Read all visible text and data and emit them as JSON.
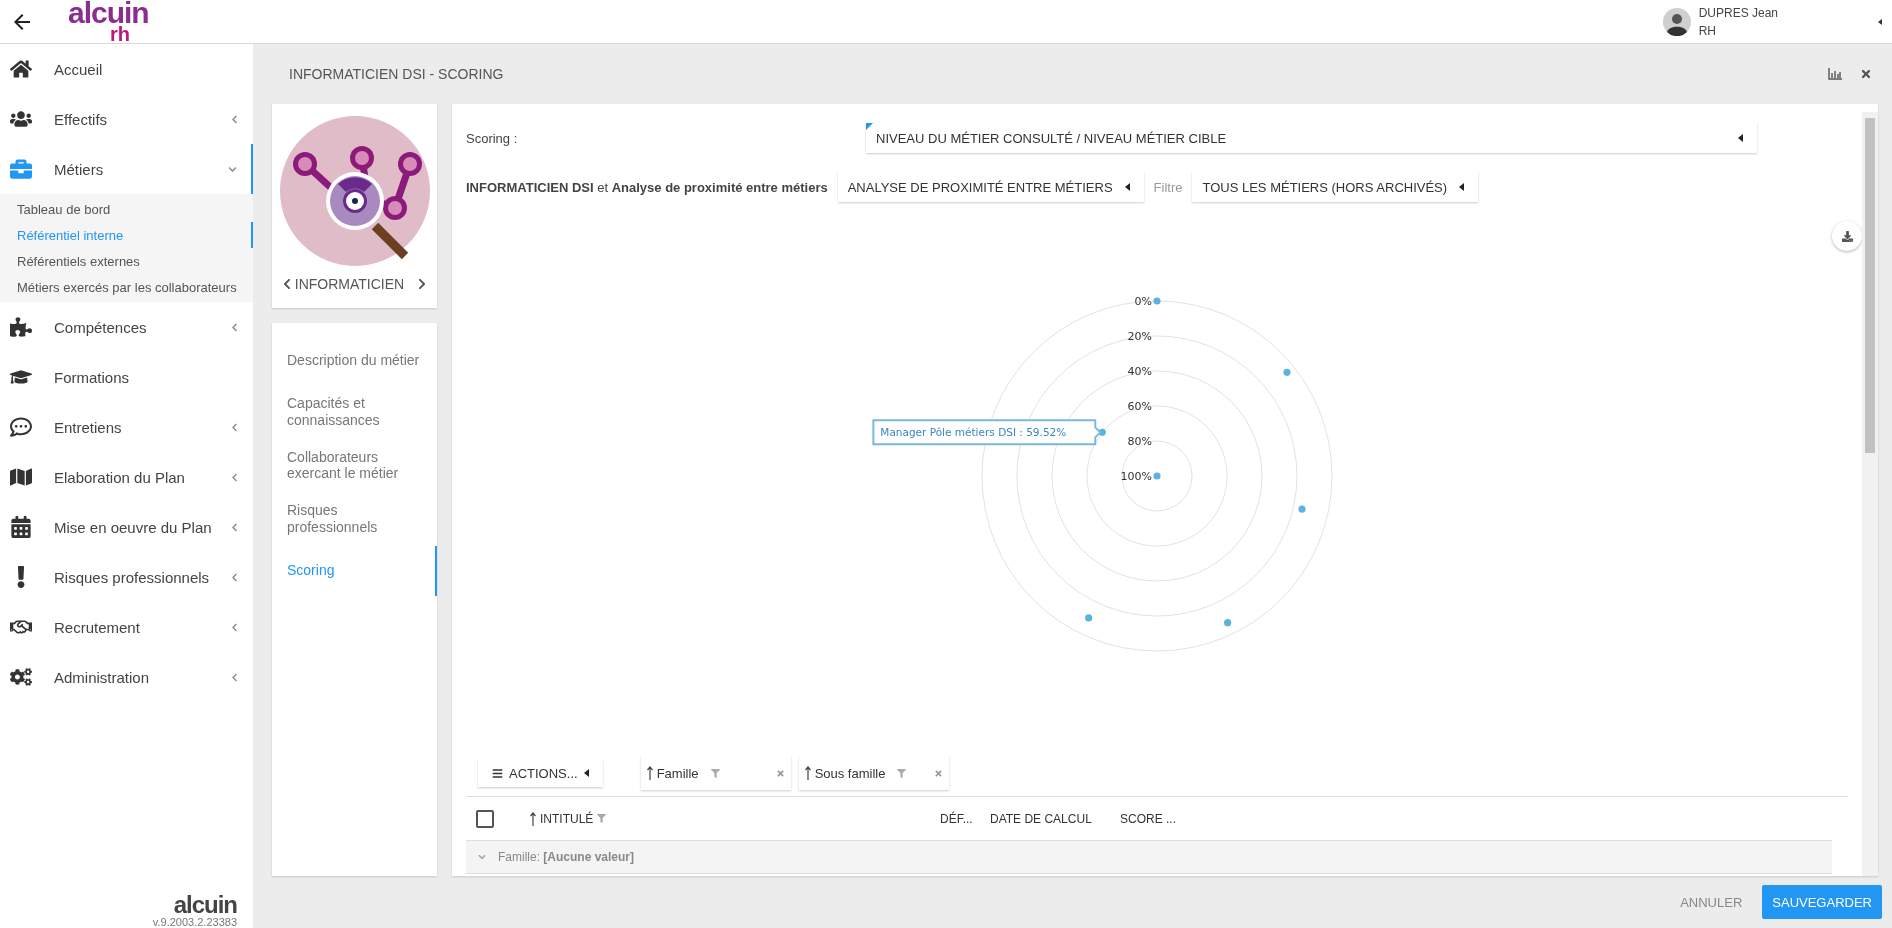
{
  "header": {
    "logo": {
      "name": "alcuin",
      "suffix": "rh"
    },
    "user": {
      "name": "DUPRES Jean",
      "role": "RH"
    }
  },
  "sidebar": {
    "items": [
      {
        "label": "Accueil",
        "kind": "link"
      },
      {
        "label": "Effectifs",
        "kind": "group",
        "expanded": false
      },
      {
        "label": "Métiers",
        "kind": "group",
        "expanded": true,
        "children": [
          {
            "label": "Tableau de bord",
            "selected": false
          },
          {
            "label": "Référentiel interne",
            "selected": true
          },
          {
            "label": "Référentiels externes",
            "selected": false
          },
          {
            "label": "Métiers exercés par les collaborateurs",
            "selected": false
          }
        ]
      },
      {
        "label": "Compétences",
        "kind": "group",
        "expanded": false
      },
      {
        "label": "Formations",
        "kind": "link"
      },
      {
        "label": "Entretiens",
        "kind": "group",
        "expanded": false
      },
      {
        "label": "Elaboration du Plan",
        "kind": "group",
        "expanded": false
      },
      {
        "label": "Mise en oeuvre du Plan",
        "kind": "group",
        "expanded": false
      },
      {
        "label": "Risques professionnels",
        "kind": "group",
        "expanded": false
      },
      {
        "label": "Recrutement",
        "kind": "group",
        "expanded": false
      },
      {
        "label": "Administration",
        "kind": "group",
        "expanded": false
      }
    ],
    "footer": {
      "logo": "alcuin",
      "version": "v.9.2003.2.23383"
    }
  },
  "page": {
    "title": "INFORMATICIEN DSI - SCORING"
  },
  "job_card": {
    "label": "INFORMATICIEN"
  },
  "job_nav": [
    {
      "label": "Description du métier",
      "selected": false
    },
    {
      "label": "Capacités et connaissances",
      "selected": false
    },
    {
      "label": "Collaborateurs exercant le métier",
      "selected": false
    },
    {
      "label": "Risques professionnels",
      "selected": false
    },
    {
      "label": "Scoring",
      "selected": true
    }
  ],
  "scoring": {
    "label": "Scoring :",
    "value": "NIVEAU DU MÉTIER CONSULTÉ / NIVEAU MÉTIER CIBLE"
  },
  "comparison": {
    "text": "**INFORMATICIEN DSI** et **Analyse de proximité entre métiers**",
    "analysis": "ANALYSE DE PROXIMITÉ ENTRE MÉTIERS",
    "filter_label": "Filtre",
    "filter": "TOUS LES MÉTIERS (HORS ARCHIVÉS)"
  },
  "chart": {
    "ring_labels": [
      "0%",
      "20%",
      "40%",
      "60%",
      "80%",
      "100%"
    ],
    "tooltip": "Manager Pôle métiers DSI : 59.52%"
  },
  "table": {
    "actions": "ACTIONS...",
    "select_all": {
      "checked": false
    },
    "group_by": [
      {
        "label": "Famille"
      },
      {
        "label": "Sous famille"
      }
    ],
    "columns": [
      {
        "label": "INTITULÉ",
        "sorted": true,
        "filterable": true
      },
      {
        "label": "DÉF...",
        "sorted": false,
        "filterable": false
      },
      {
        "label": "DATE DE CALCUL",
        "sorted": false,
        "filterable": false
      },
      {
        "label": "SCORE ...",
        "sorted": false,
        "filterable": false
      }
    ],
    "groups": [
      {
        "label": "Famille: **[Aucune valeur]**",
        "expanded": true
      }
    ]
  },
  "footer": {
    "cancel": "ANNULER",
    "save": "SAUVEGARDER"
  }
}
